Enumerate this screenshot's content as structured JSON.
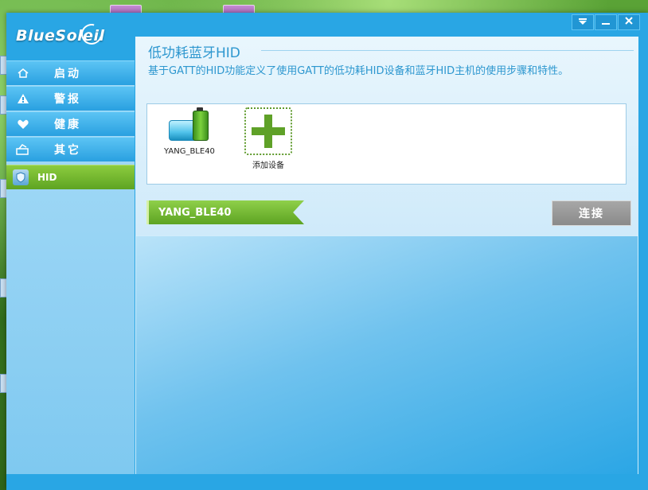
{
  "window": {
    "brand": "BlueSoleil",
    "buttons": {
      "menu_icon": "dropdown-arrow-icon",
      "minimize_icon": "minimize-icon",
      "close_icon": "close-icon"
    }
  },
  "sidebar": {
    "items": [
      {
        "label": "启动",
        "icon": "home-icon"
      },
      {
        "label": "警报",
        "icon": "warning-icon"
      },
      {
        "label": "健康",
        "icon": "heart-icon"
      },
      {
        "label": "其它",
        "icon": "other-icon"
      },
      {
        "label": "HID",
        "icon": "hid-icon",
        "active": true
      }
    ]
  },
  "panel": {
    "title": "低功耗蓝牙HID",
    "description": "基于GATT的HID功能定义了使用GATT的低功耗HID设备和蓝牙HID主机的使用步骤和特性。",
    "devices": [
      {
        "label": "YANG_BLE40",
        "icon": "ble-device-icon"
      },
      {
        "label": "添加设备",
        "icon": "add-device-icon"
      }
    ],
    "selected_device": "YANG_BLE40",
    "connect_label": "连接"
  },
  "colors": {
    "accent_blue": "#29a6e4",
    "active_green": "#6fb52e",
    "connect_gray": "#999999"
  }
}
